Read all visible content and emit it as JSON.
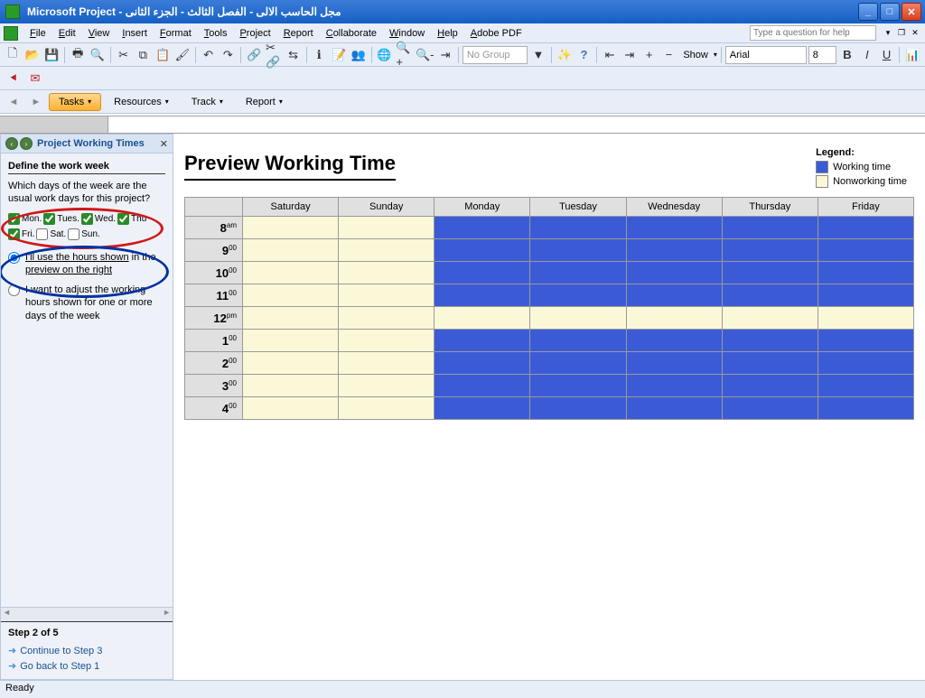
{
  "titlebar": {
    "app": "Microsoft Project",
    "doc": "مجل الحاسب الالى - الفصل الثالث - الجزء الثانى"
  },
  "menus": [
    "File",
    "Edit",
    "View",
    "Insert",
    "Format",
    "Tools",
    "Project",
    "Report",
    "Collaborate",
    "Window",
    "Help",
    "Adobe PDF"
  ],
  "helpbox_placeholder": "Type a question for help",
  "toolbar_group": "No Group",
  "toolbar_show": "Show",
  "toolbar_font": "Arial",
  "toolbar_size": "8",
  "guide_tabs": {
    "tasks": "Tasks",
    "resources": "Resources",
    "track": "Track",
    "report": "Report"
  },
  "sidepanel": {
    "title": "Project Working Times",
    "section_title": "Define the work week",
    "question": "Which days of the week are the usual work days for this project?",
    "days": [
      {
        "label": "Mon.",
        "checked": true
      },
      {
        "label": "Tues.",
        "checked": true
      },
      {
        "label": "Wed.",
        "checked": true
      },
      {
        "label": "Thu",
        "checked": true
      },
      {
        "label": "Fri.",
        "checked": true
      },
      {
        "label": "Sat.",
        "checked": false
      },
      {
        "label": "Sun.",
        "checked": false
      }
    ],
    "radio1_a": "I'll use the hours shown",
    "radio1_b": "in the ",
    "radio1_c": "preview on the right",
    "radio2": "I want to adjust the working hours shown for one or more days of the week",
    "step": "Step 2 of 5",
    "continue": "Continue to Step 3",
    "goback": "Go back to Step 1"
  },
  "content": {
    "title": "Preview Working Time",
    "legend_title": "Legend:",
    "legend_work": "Working time",
    "legend_nonwork": "Nonworking time",
    "day_headers": [
      "Saturday",
      "Sunday",
      "Monday",
      "Tuesday",
      "Wednesday",
      "Thursday",
      "Friday"
    ],
    "time_rows": [
      {
        "h": "8",
        "m": "am",
        "work": [
          false,
          false,
          true,
          true,
          true,
          true,
          true
        ]
      },
      {
        "h": "9",
        "m": "00",
        "work": [
          false,
          false,
          true,
          true,
          true,
          true,
          true
        ]
      },
      {
        "h": "10",
        "m": "00",
        "work": [
          false,
          false,
          true,
          true,
          true,
          true,
          true
        ]
      },
      {
        "h": "11",
        "m": "00",
        "work": [
          false,
          false,
          true,
          true,
          true,
          true,
          true
        ]
      },
      {
        "h": "12",
        "m": "pm",
        "work": [
          false,
          false,
          false,
          false,
          false,
          false,
          false
        ]
      },
      {
        "h": "1",
        "m": "00",
        "work": [
          false,
          false,
          true,
          true,
          true,
          true,
          true
        ]
      },
      {
        "h": "2",
        "m": "00",
        "work": [
          false,
          false,
          true,
          true,
          true,
          true,
          true
        ]
      },
      {
        "h": "3",
        "m": "00",
        "work": [
          false,
          false,
          true,
          true,
          true,
          true,
          true
        ]
      },
      {
        "h": "4",
        "m": "00",
        "work": [
          false,
          false,
          true,
          true,
          true,
          true,
          true
        ]
      }
    ]
  },
  "status": "Ready"
}
